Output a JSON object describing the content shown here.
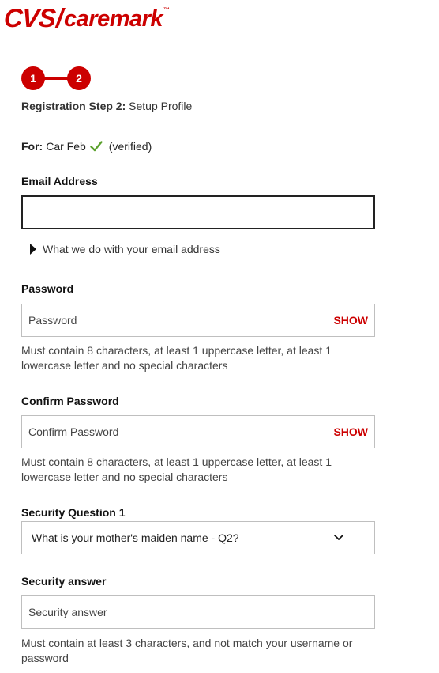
{
  "brand": {
    "logo_cvs": "CVS",
    "logo_slash": "/",
    "logo_caremark": "caremark",
    "logo_tm": "™",
    "accent_color": "#cc0000"
  },
  "stepper": {
    "step1": "1",
    "step2": "2",
    "title_bold": "Registration Step 2:",
    "title_rest": "Setup Profile"
  },
  "member": {
    "for_label": "For:",
    "name": "Car Feb",
    "verified_text": "(verified)",
    "check_icon": "checkmark-icon",
    "check_color": "#5aa02c"
  },
  "email": {
    "label": "Email Address",
    "value": "",
    "disclosure_text": "What we do with your email address"
  },
  "password": {
    "label": "Password",
    "placeholder": "Password",
    "show_label": "SHOW",
    "hint": "Must contain 8 characters, at least 1 uppercase letter, at least 1 lowercase letter and no special characters"
  },
  "confirm_password": {
    "label": "Confirm Password",
    "placeholder": "Confirm Password",
    "show_label": "SHOW",
    "hint": "Must contain 8 characters, at least 1 uppercase letter, at least 1 lowercase letter and no special characters"
  },
  "security_question": {
    "label": "Security Question 1",
    "selected": "What is your mother's maiden name - Q2?"
  },
  "security_answer": {
    "label": "Security answer",
    "placeholder": "Security answer",
    "hint": "Must contain at least 3 characters, and not match your username or password"
  }
}
